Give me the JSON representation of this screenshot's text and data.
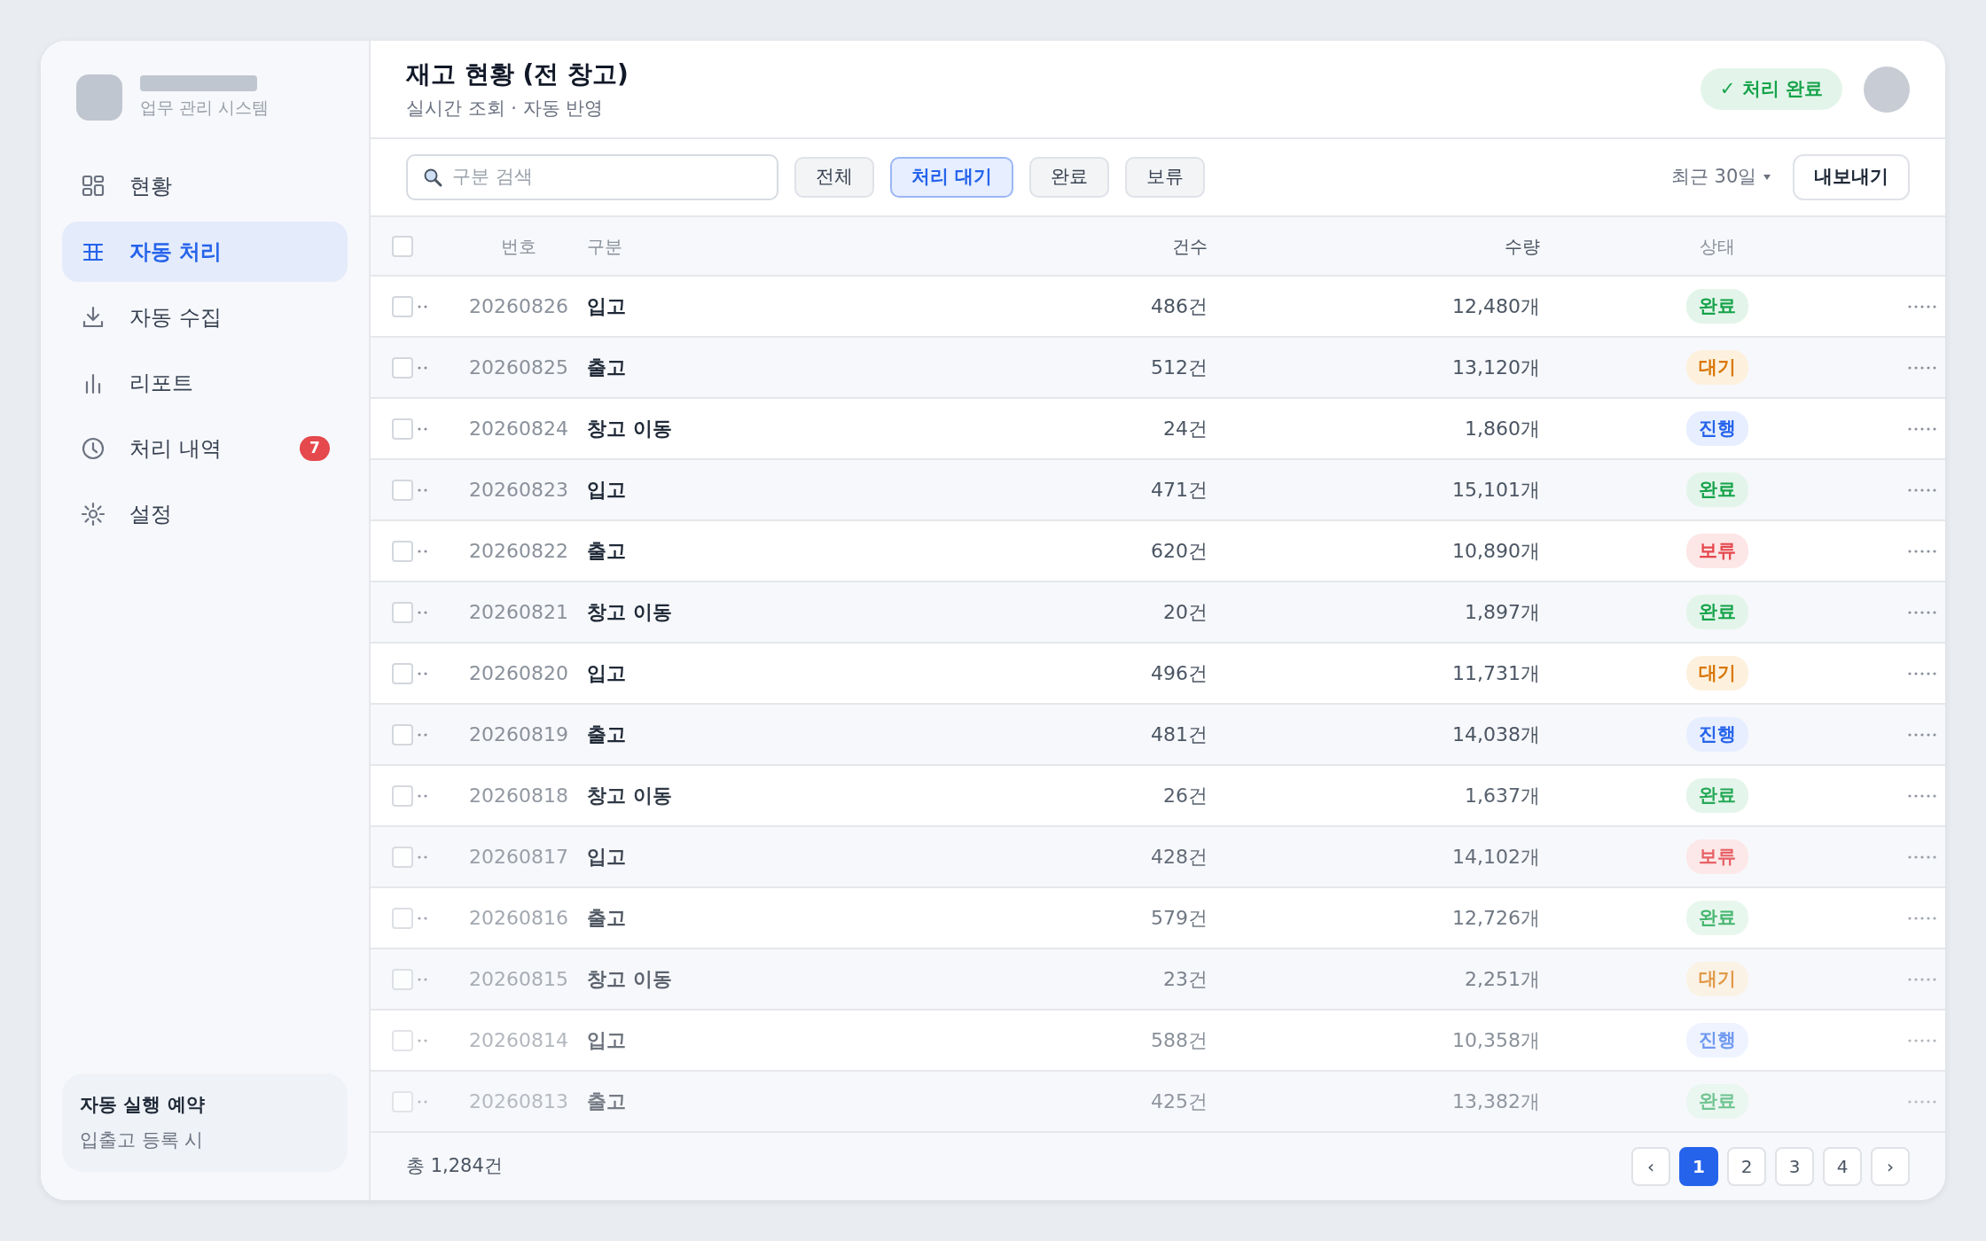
{
  "sidebar": {
    "brand_subtitle": "업무 관리 시스템",
    "items": [
      {
        "kind": "grid",
        "label": "현황",
        "selected": false
      },
      {
        "kind": "table",
        "label": "자동 처리",
        "selected": true
      },
      {
        "kind": "download",
        "label": "자동 수집",
        "selected": false
      },
      {
        "kind": "bars",
        "label": "리포트",
        "selected": false
      },
      {
        "kind": "clock",
        "label": "처리 내역",
        "selected": false,
        "badge": "7"
      },
      {
        "kind": "sun",
        "label": "설정",
        "selected": false
      }
    ],
    "schedule": {
      "title": "자동 실행 예약",
      "subtitle": "입출고 등록 시"
    }
  },
  "header": {
    "title": "재고 현황 (전 창고)",
    "subtitle": "실시간 조회 · 자동 반영",
    "status_badge": "✓ 처리 완료"
  },
  "toolbar": {
    "search": {
      "placeholder": "구분 검색"
    },
    "filters": [
      {
        "label": "전체",
        "selected": false
      },
      {
        "label": "처리 대기",
        "selected": true
      },
      {
        "label": "완료",
        "selected": false
      },
      {
        "label": "보류",
        "selected": false
      }
    ],
    "period": "최근 30일",
    "export": "내보내기"
  },
  "table": {
    "select_all": {
      "checked": false
    },
    "columns": [
      "번호",
      "구분",
      "건수",
      "수량",
      "상태"
    ],
    "rows": [
      {
        "checked": false,
        "number": "20260826",
        "type": "입고",
        "count": "486건",
        "quantity": "12,480개",
        "status": "완료",
        "kind": "done"
      },
      {
        "checked": false,
        "number": "20260825",
        "type": "출고",
        "count": "512건",
        "quantity": "13,120개",
        "status": "대기",
        "kind": "waiting"
      },
      {
        "checked": false,
        "number": "20260824",
        "type": "창고 이동",
        "count": "24건",
        "quantity": "1,860개",
        "status": "진행",
        "kind": "progress"
      },
      {
        "checked": false,
        "number": "20260823",
        "type": "입고",
        "count": "471건",
        "quantity": "15,101개",
        "status": "완료",
        "kind": "done"
      },
      {
        "checked": false,
        "number": "20260822",
        "type": "출고",
        "count": "620건",
        "quantity": "10,890개",
        "status": "보류",
        "kind": "hold"
      },
      {
        "checked": false,
        "number": "20260821",
        "type": "창고 이동",
        "count": "20건",
        "quantity": "1,897개",
        "status": "완료",
        "kind": "done"
      },
      {
        "checked": false,
        "number": "20260820",
        "type": "입고",
        "count": "496건",
        "quantity": "11,731개",
        "status": "대기",
        "kind": "waiting"
      },
      {
        "checked": false,
        "number": "20260819",
        "type": "출고",
        "count": "481건",
        "quantity": "14,038개",
        "status": "진행",
        "kind": "progress"
      },
      {
        "checked": false,
        "number": "20260818",
        "type": "창고 이동",
        "count": "26건",
        "quantity": "1,637개",
        "status": "완료",
        "kind": "done"
      },
      {
        "checked": false,
        "number": "20260817",
        "type": "입고",
        "count": "428건",
        "quantity": "14,102개",
        "status": "보류",
        "kind": "hold"
      },
      {
        "checked": false,
        "number": "20260816",
        "type": "출고",
        "count": "579건",
        "quantity": "12,726개",
        "status": "완료",
        "kind": "done"
      },
      {
        "checked": false,
        "number": "20260815",
        "type": "창고 이동",
        "count": "23건",
        "quantity": "2,251개",
        "status": "대기",
        "kind": "waiting"
      },
      {
        "checked": false,
        "number": "20260814",
        "type": "입고",
        "count": "588건",
        "quantity": "10,358개",
        "status": "진행",
        "kind": "progress"
      },
      {
        "checked": false,
        "number": "20260813",
        "type": "출고",
        "count": "425건",
        "quantity": "13,382개",
        "status": "완료",
        "kind": "done"
      }
    ]
  },
  "footer": {
    "total": "총 1,284건",
    "pagination": {
      "prev": "‹",
      "next": "›",
      "pages": [
        {
          "label": "1",
          "selected": true
        },
        {
          "label": "2",
          "selected": false
        },
        {
          "label": "3",
          "selected": false
        },
        {
          "label": "4",
          "selected": false
        }
      ]
    }
  }
}
